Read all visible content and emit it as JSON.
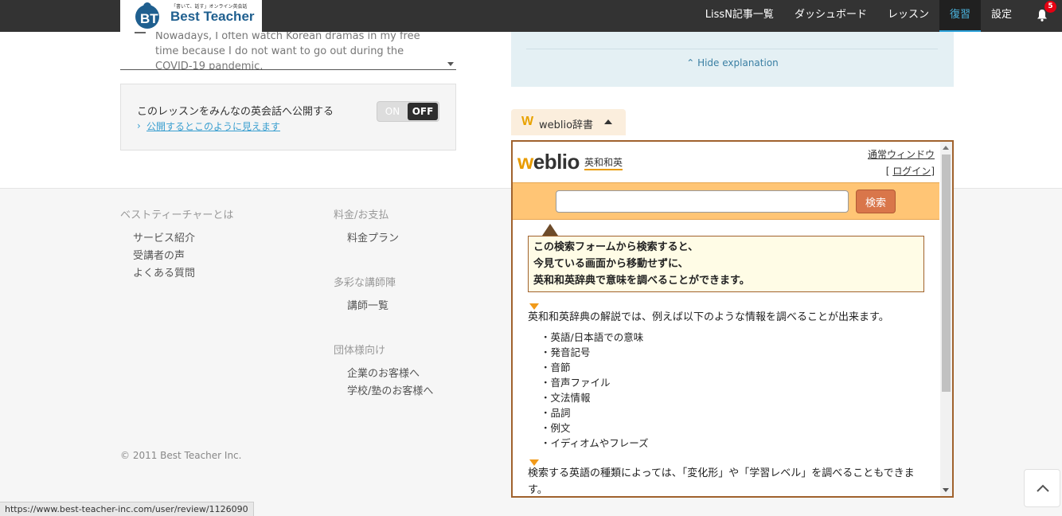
{
  "header": {
    "logo_tagline": "「書いて、話す」オンライン英会話",
    "logo_name": "Best Teacher",
    "nav": [
      {
        "label": "LissN記事一覧",
        "active": false
      },
      {
        "label": "ダッシュボード",
        "active": false
      },
      {
        "label": "レッスン",
        "active": false
      },
      {
        "label": "復習",
        "active": true
      },
      {
        "label": "設定",
        "active": false
      }
    ],
    "notification_count": "5"
  },
  "answer_text": "Nowadays, I often watch Korean dramas in my free time because I do not want to go out during the COVID-19 pandemic.",
  "publish": {
    "label": "このレッスンをみんなの英会話へ公開する",
    "toggle_on": "ON",
    "toggle_off": "OFF",
    "toggle_state": "off",
    "preview_link": "公開するとこのように見えます"
  },
  "explanation": {
    "hide_label": "Hide explanation"
  },
  "weblio": {
    "tab_label": "weblio辞書",
    "logo_w": "w",
    "logo_rest": "eblio",
    "subtitle": "英和和英",
    "normal_window": "通常ウィンドウ",
    "login_prefix": "[ ",
    "login": "ログイン",
    "login_suffix": "]",
    "search_value": "",
    "search_button": "検索",
    "note_lines": [
      "この検索フォームから検索すると、",
      "今見ている画面から移動せずに、",
      "英和和英辞典で意味を調べることができます。"
    ],
    "para1": "英和和英辞典の解説では、例えば以下のような情報を調べることが出来ます。",
    "list": [
      "英語/日本語での意味",
      "発音記号",
      "音節",
      "音声ファイル",
      "文法情報",
      "品詞",
      "例文",
      "イディオムやフレーズ"
    ],
    "para2": "検索する英語の種類によっては、「変化形」や「学習レベル」を調べることもできます。"
  },
  "footer": {
    "col1": {
      "heading": "ベストティーチャーとは",
      "links": [
        "サービス紹介",
        "受講者の声",
        "よくある質問"
      ]
    },
    "col2": {
      "heading": "料金/お支払",
      "links": [
        "料金プラン"
      ]
    },
    "col3": {
      "heading": "多彩な講師陣",
      "links": [
        "講師一覧"
      ]
    },
    "col4": {
      "heading": "団体様向け",
      "links": [
        "企業のお客様へ",
        "学校/塾のお客様へ"
      ]
    },
    "copyright": "© 2011 Best Teacher Inc."
  },
  "status_url": "https://www.best-teacher-inc.com/user/review/1126090",
  "colors": {
    "header_bg": "#333333",
    "active_nav": "#4bb5e0",
    "weblio_border": "#a0622d",
    "weblio_search_bar": "#ffc575",
    "badge": "#e60012"
  }
}
